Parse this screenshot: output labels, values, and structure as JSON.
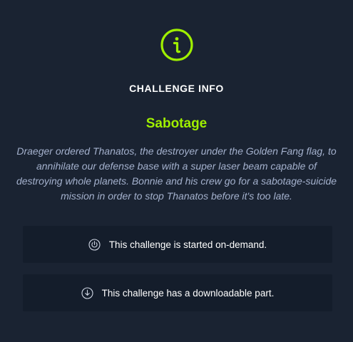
{
  "icon": "info-circle-icon",
  "accent_color": "#9fef00",
  "heading": "CHALLENGE INFO",
  "challenge": {
    "name": "Sabotage",
    "description": "Draeger ordered Thanatos, the destroyer under the Golden Fang flag, to annihilate our defense base with a super laser beam capable of destroying whole planets. Bonnie and his crew go for a sabotage-suicide mission in order to stop Thanatos before it's too late."
  },
  "features": [
    {
      "icon": "power-icon",
      "text": "This challenge is started on-demand."
    },
    {
      "icon": "download-icon",
      "text": "This challenge has a downloadable part."
    }
  ]
}
